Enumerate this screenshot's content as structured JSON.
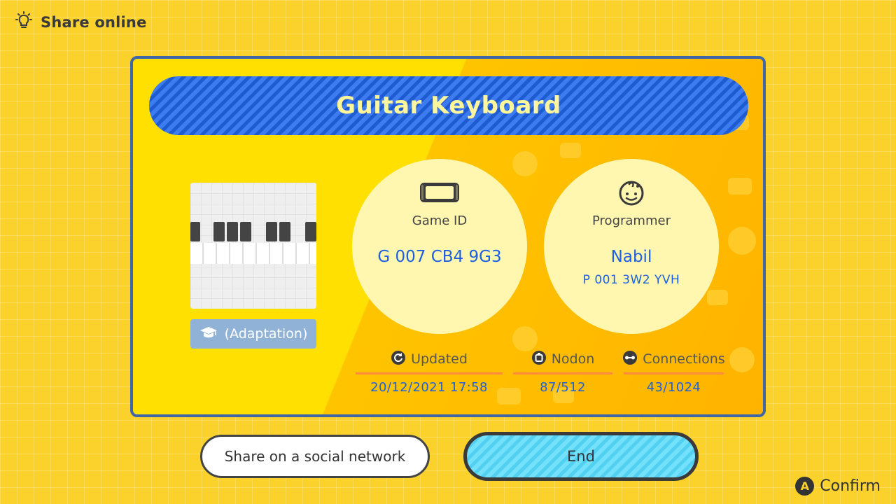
{
  "header": {
    "title": "Share online",
    "icon": "lightbulb-icon"
  },
  "game": {
    "title": "Guitar Keyboard",
    "badge": "(Adaptation)",
    "badge_icon": "graduation-cap-icon"
  },
  "game_id": {
    "label": "Game ID",
    "value": "G 007 CB4 9G3",
    "icon": "console-icon"
  },
  "programmer": {
    "label": "Programmer",
    "name": "Nabil",
    "id": "P 001 3W2 YVH",
    "icon": "face-icon"
  },
  "stats": {
    "updated": {
      "label": "Updated",
      "value": "20/12/2021 17:58",
      "icon": "refresh-icon"
    },
    "nodon": {
      "label": "Nodon",
      "value": "87/512",
      "icon": "nodon-icon"
    },
    "connections": {
      "label": "Connections",
      "value": "43/1024",
      "icon": "link-icon"
    }
  },
  "buttons": {
    "share": "Share on a social network",
    "end": "End"
  },
  "footer": {
    "button_glyph": "A",
    "label": "Confirm"
  },
  "colors": {
    "accent_blue": "#2f6fe6",
    "value_blue": "#1d5fe0",
    "end_button": "#5fd8f6",
    "underline": "#ff8a3d"
  }
}
